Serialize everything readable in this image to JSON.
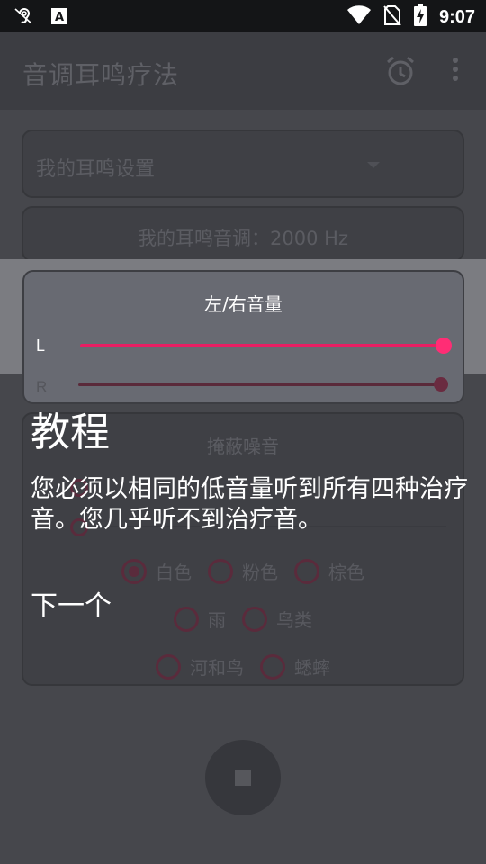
{
  "status_bar": {
    "time": "9:07",
    "icons": [
      "hearing-icon",
      "font-a-icon",
      "wifi-icon",
      "no-sim-icon",
      "battery-charging-icon"
    ]
  },
  "app_bar": {
    "title": "音调耳鸣疗法",
    "actions": [
      "alarm-icon",
      "more-vert-icon"
    ]
  },
  "settings": {
    "preset_label": "我的耳鸣设置",
    "tone_label": "我的耳鸣音调：2000 Hz"
  },
  "volume": {
    "title": "左/右音量",
    "left_label": "L",
    "right_label": "R",
    "left_level": 1.0,
    "right_level": 1.0
  },
  "masking": {
    "title": "掩蔽噪音",
    "options": [
      {
        "label": "白色",
        "selected": true
      },
      {
        "label": "粉色",
        "selected": false
      },
      {
        "label": "棕色",
        "selected": false
      },
      {
        "label": "雨",
        "selected": false
      },
      {
        "label": "鸟类",
        "selected": false
      },
      {
        "label": "河和鸟",
        "selected": false
      },
      {
        "label": "蟋蟀",
        "selected": false
      }
    ]
  },
  "tutorial": {
    "title": "教程",
    "body": "您必须以相同的低音量听到所有四种治疗音。您几乎听不到治疗音。",
    "next": "下一个"
  },
  "colors": {
    "accent": "#e91e63",
    "overlay": "#46474c",
    "highlight_card": "#686a72"
  }
}
